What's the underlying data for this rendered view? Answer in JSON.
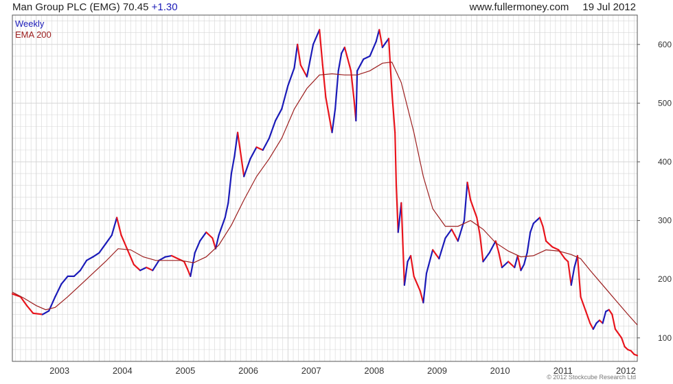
{
  "header": {
    "instrument": "Man Group PLC (EMG)",
    "last": "70.45",
    "change": "+1.30",
    "source": "www.fullermoney.com",
    "date": "19 Jul 2012"
  },
  "legend": {
    "weekly": "Weekly",
    "ema": "EMA 200"
  },
  "copyright": "© 2012 Stockcube Research Ltd",
  "colors": {
    "up": "#1a1ab8",
    "down": "#e8141c",
    "ema": "#9b1c1c",
    "grid": "#d6d6d6",
    "axis": "#555555"
  },
  "chart_data": {
    "type": "line",
    "title": "Man Group PLC (EMG)",
    "xlabel": "",
    "ylabel": "",
    "xlim": [
      2002.62,
      2012.55
    ],
    "ylim": [
      60,
      650
    ],
    "x_ticks": [
      2003,
      2004,
      2005,
      2006,
      2007,
      2008,
      2009,
      2010,
      2011,
      2012
    ],
    "y_ticks": [
      100,
      200,
      300,
      400,
      500,
      600
    ],
    "grid": true,
    "legend_position": "top-left",
    "series": [
      {
        "name": "Weekly",
        "points": [
          [
            2002.62,
            175
          ],
          [
            2002.75,
            170
          ],
          [
            2002.85,
            155
          ],
          [
            2002.95,
            142
          ],
          [
            2003.1,
            140
          ],
          [
            2003.2,
            146
          ],
          [
            2003.3,
            170
          ],
          [
            2003.4,
            192
          ],
          [
            2003.5,
            205
          ],
          [
            2003.6,
            205
          ],
          [
            2003.7,
            215
          ],
          [
            2003.8,
            232
          ],
          [
            2003.9,
            238
          ],
          [
            2004.0,
            245
          ],
          [
            2004.1,
            260
          ],
          [
            2004.2,
            275
          ],
          [
            2004.28,
            305
          ],
          [
            2004.35,
            275
          ],
          [
            2004.45,
            250
          ],
          [
            2004.55,
            225
          ],
          [
            2004.65,
            215
          ],
          [
            2004.75,
            220
          ],
          [
            2004.85,
            215
          ],
          [
            2004.95,
            232
          ],
          [
            2005.05,
            238
          ],
          [
            2005.15,
            240
          ],
          [
            2005.25,
            235
          ],
          [
            2005.35,
            230
          ],
          [
            2005.4,
            218
          ],
          [
            2005.45,
            205
          ],
          [
            2005.52,
            245
          ],
          [
            2005.6,
            265
          ],
          [
            2005.7,
            280
          ],
          [
            2005.8,
            270
          ],
          [
            2005.85,
            252
          ],
          [
            2005.9,
            275
          ],
          [
            2006.0,
            305
          ],
          [
            2006.05,
            330
          ],
          [
            2006.1,
            380
          ],
          [
            2006.15,
            410
          ],
          [
            2006.2,
            450
          ],
          [
            2006.3,
            375
          ],
          [
            2006.4,
            405
          ],
          [
            2006.5,
            425
          ],
          [
            2006.6,
            420
          ],
          [
            2006.7,
            440
          ],
          [
            2006.8,
            470
          ],
          [
            2006.9,
            490
          ],
          [
            2007.0,
            530
          ],
          [
            2007.1,
            560
          ],
          [
            2007.15,
            600
          ],
          [
            2007.2,
            565
          ],
          [
            2007.3,
            545
          ],
          [
            2007.4,
            600
          ],
          [
            2007.5,
            625
          ],
          [
            2007.55,
            565
          ],
          [
            2007.6,
            510
          ],
          [
            2007.7,
            450
          ],
          [
            2007.75,
            490
          ],
          [
            2007.8,
            555
          ],
          [
            2007.85,
            585
          ],
          [
            2007.9,
            595
          ],
          [
            2008.0,
            555
          ],
          [
            2008.05,
            505
          ],
          [
            2008.08,
            470
          ],
          [
            2008.1,
            555
          ],
          [
            2008.2,
            575
          ],
          [
            2008.3,
            580
          ],
          [
            2008.4,
            605
          ],
          [
            2008.45,
            625
          ],
          [
            2008.5,
            595
          ],
          [
            2008.6,
            610
          ],
          [
            2008.65,
            520
          ],
          [
            2008.7,
            450
          ],
          [
            2008.72,
            360
          ],
          [
            2008.75,
            280
          ],
          [
            2008.8,
            330
          ],
          [
            2008.85,
            190
          ],
          [
            2008.9,
            230
          ],
          [
            2008.95,
            240
          ],
          [
            2009.0,
            205
          ],
          [
            2009.1,
            180
          ],
          [
            2009.15,
            160
          ],
          [
            2009.2,
            210
          ],
          [
            2009.3,
            250
          ],
          [
            2009.4,
            235
          ],
          [
            2009.5,
            270
          ],
          [
            2009.6,
            285
          ],
          [
            2009.65,
            275
          ],
          [
            2009.7,
            265
          ],
          [
            2009.8,
            300
          ],
          [
            2009.85,
            365
          ],
          [
            2009.9,
            335
          ],
          [
            2009.95,
            320
          ],
          [
            2010.0,
            305
          ],
          [
            2010.05,
            275
          ],
          [
            2010.1,
            230
          ],
          [
            2010.2,
            245
          ],
          [
            2010.3,
            265
          ],
          [
            2010.35,
            245
          ],
          [
            2010.4,
            220
          ],
          [
            2010.5,
            230
          ],
          [
            2010.6,
            220
          ],
          [
            2010.65,
            240
          ],
          [
            2010.7,
            215
          ],
          [
            2010.75,
            225
          ],
          [
            2010.8,
            245
          ],
          [
            2010.85,
            280
          ],
          [
            2010.9,
            295
          ],
          [
            2010.95,
            300
          ],
          [
            2011.0,
            305
          ],
          [
            2011.05,
            290
          ],
          [
            2011.1,
            265
          ],
          [
            2011.2,
            255
          ],
          [
            2011.3,
            250
          ],
          [
            2011.4,
            235
          ],
          [
            2011.45,
            230
          ],
          [
            2011.5,
            190
          ],
          [
            2011.55,
            220
          ],
          [
            2011.6,
            240
          ],
          [
            2011.65,
            170
          ],
          [
            2011.7,
            155
          ],
          [
            2011.75,
            140
          ],
          [
            2011.8,
            125
          ],
          [
            2011.85,
            115
          ],
          [
            2011.9,
            125
          ],
          [
            2011.95,
            130
          ],
          [
            2012.0,
            125
          ],
          [
            2012.05,
            145
          ],
          [
            2012.1,
            148
          ],
          [
            2012.15,
            140
          ],
          [
            2012.2,
            115
          ],
          [
            2012.3,
            100
          ],
          [
            2012.35,
            85
          ],
          [
            2012.4,
            80
          ],
          [
            2012.45,
            78
          ],
          [
            2012.5,
            72
          ],
          [
            2012.55,
            70
          ]
        ]
      },
      {
        "name": "EMA 200",
        "points": [
          [
            2002.62,
            178
          ],
          [
            2002.8,
            168
          ],
          [
            2003.0,
            155
          ],
          [
            2003.15,
            148
          ],
          [
            2003.3,
            152
          ],
          [
            2003.5,
            170
          ],
          [
            2003.7,
            190
          ],
          [
            2003.9,
            210
          ],
          [
            2004.1,
            230
          ],
          [
            2004.3,
            252
          ],
          [
            2004.5,
            250
          ],
          [
            2004.7,
            238
          ],
          [
            2004.9,
            232
          ],
          [
            2005.1,
            232
          ],
          [
            2005.3,
            232
          ],
          [
            2005.5,
            228
          ],
          [
            2005.7,
            238
          ],
          [
            2005.9,
            258
          ],
          [
            2006.1,
            292
          ],
          [
            2006.3,
            335
          ],
          [
            2006.5,
            375
          ],
          [
            2006.7,
            405
          ],
          [
            2006.9,
            440
          ],
          [
            2007.1,
            490
          ],
          [
            2007.3,
            525
          ],
          [
            2007.5,
            548
          ],
          [
            2007.7,
            550
          ],
          [
            2007.9,
            548
          ],
          [
            2008.1,
            548
          ],
          [
            2008.3,
            555
          ],
          [
            2008.5,
            568
          ],
          [
            2008.65,
            570
          ],
          [
            2008.8,
            535
          ],
          [
            2009.0,
            450
          ],
          [
            2009.15,
            375
          ],
          [
            2009.3,
            320
          ],
          [
            2009.5,
            290
          ],
          [
            2009.7,
            290
          ],
          [
            2009.9,
            300
          ],
          [
            2010.1,
            285
          ],
          [
            2010.3,
            262
          ],
          [
            2010.5,
            248
          ],
          [
            2010.7,
            238
          ],
          [
            2010.9,
            240
          ],
          [
            2011.1,
            250
          ],
          [
            2011.3,
            248
          ],
          [
            2011.5,
            242
          ],
          [
            2011.65,
            235
          ],
          [
            2011.8,
            215
          ],
          [
            2012.0,
            190
          ],
          [
            2012.2,
            165
          ],
          [
            2012.4,
            140
          ],
          [
            2012.55,
            122
          ]
        ]
      }
    ]
  }
}
